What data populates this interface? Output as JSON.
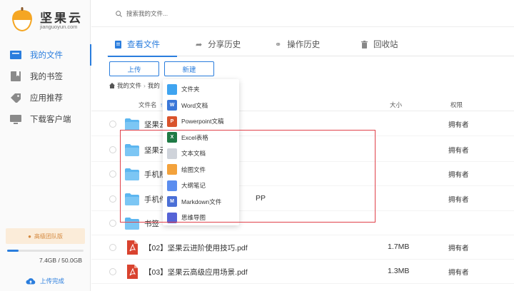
{
  "brand": {
    "name": "坚果云",
    "subtitle": "jianguoyun.com"
  },
  "sidebar": {
    "items": [
      {
        "label": "我的文件",
        "icon": "files-icon",
        "active": true
      },
      {
        "label": "我的书签",
        "icon": "bookmark-icon",
        "active": false
      },
      {
        "label": "应用推荐",
        "icon": "tag-icon",
        "active": false
      },
      {
        "label": "下载客户端",
        "icon": "monitor-icon",
        "active": false
      }
    ],
    "upgrade_label": "高级团队版",
    "quota": {
      "text": "7.4GB / 50.0GB",
      "used_fraction": 0.148
    },
    "upload_status": "上传完成"
  },
  "search": {
    "placeholder": "搜索我的文件..."
  },
  "tabs": [
    {
      "label": "查看文件",
      "icon": "file-icon",
      "active": true
    },
    {
      "label": "分享历史",
      "icon": "share-icon",
      "active": false
    },
    {
      "label": "操作历史",
      "icon": "history-icon",
      "active": false
    },
    {
      "label": "回收站",
      "icon": "trash-icon",
      "active": false
    }
  ],
  "toolbar": {
    "upload_label": "上传",
    "new_label": "新建"
  },
  "breadcrumb": {
    "root": "我的文件",
    "current": "我的"
  },
  "table": {
    "headers": {
      "name": "文件名",
      "size": "大小",
      "permission": "权限"
    },
    "rows": [
      {
        "name": "坚果云",
        "type": "folder",
        "size": "",
        "permission": "拥有者"
      },
      {
        "name": "坚果云",
        "type": "folder",
        "size": "",
        "permission": "拥有者"
      },
      {
        "name": "手机照",
        "type": "folder",
        "size": "",
        "permission": "拥有者"
      },
      {
        "name": "手机件",
        "name_tail": "PP",
        "type": "folder",
        "size": "",
        "permission": "拥有者"
      },
      {
        "name": "书签",
        "type": "folder",
        "size": "",
        "permission": ""
      },
      {
        "name": "【02】坚果云进阶使用技巧.pdf",
        "type": "pdf",
        "size": "1.7MB",
        "permission": "拥有者"
      },
      {
        "name": "【03】坚果云高级应用场景.pdf",
        "type": "pdf",
        "size": "1.3MB",
        "permission": "拥有者"
      }
    ]
  },
  "new_menu": {
    "items": [
      {
        "label": "文件夹",
        "icon": "folder-icon",
        "color": "#3fa4f0",
        "glyph": ""
      },
      {
        "label": "Word文档",
        "icon": "word-icon",
        "color": "#3a77d8",
        "glyph": "W"
      },
      {
        "label": "Powerpoint文稿",
        "icon": "ppt-icon",
        "color": "#d9532c",
        "glyph": "P"
      },
      {
        "label": "Excel表格",
        "icon": "excel-icon",
        "color": "#1f7a45",
        "glyph": "X"
      },
      {
        "label": "文本文档",
        "icon": "text-doc-icon",
        "color": "#cfd3da",
        "glyph": ""
      },
      {
        "label": "绘图文件",
        "icon": "drawing-icon",
        "color": "#f3a23c",
        "glyph": ""
      },
      {
        "label": "大纲笔记",
        "icon": "outline-icon",
        "color": "#5b8def",
        "glyph": ""
      },
      {
        "label": "Markdown文件",
        "icon": "markdown-icon",
        "color": "#4a6fd6",
        "glyph": "M"
      },
      {
        "label": "思维导图",
        "icon": "mindmap-icon",
        "color": "#5563d6",
        "glyph": ""
      }
    ]
  },
  "colors": {
    "accent": "#2a7ddd",
    "highlight": "#e0414a",
    "folder": "#5cb6f0",
    "pdf": "#d9432f"
  }
}
